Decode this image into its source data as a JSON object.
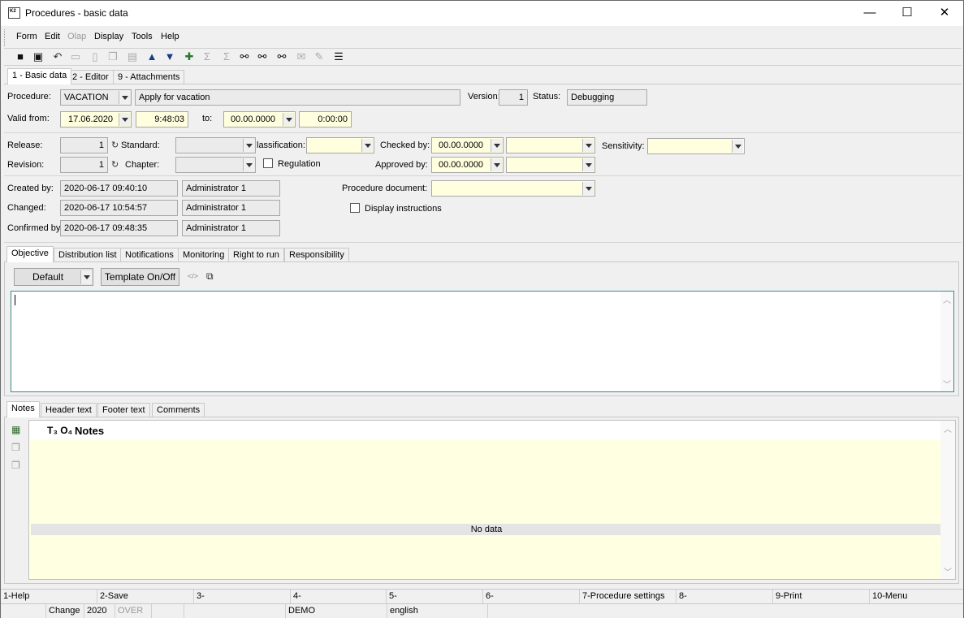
{
  "window": {
    "title": "Procedures - basic data",
    "app_icon_text": "K2",
    "minimize": "—",
    "maximize": "☐",
    "close": "✕"
  },
  "menu": [
    "Form",
    "Edit",
    "Olap",
    "Display",
    "Tools",
    "Help"
  ],
  "toolbar": [
    "save-icon",
    "save-close-icon",
    "undo-icon",
    "open-folder-icon",
    "new-page-icon",
    "copy-page-icon",
    "book-icon",
    "arrow-up-icon",
    "arrow-down-icon",
    "filter-icon",
    "sum-icon",
    "sum-filter-icon",
    "binoculars-icon",
    "binoculars-next-icon",
    "binoculars-prev-icon",
    "mail-icon",
    "edit-icon",
    "menu-lines-icon"
  ],
  "top_tabs": [
    "1 - Basic data",
    "2 - Editor",
    "9 - Attachments"
  ],
  "form": {
    "procedure_label": "Procedure:",
    "procedure_code": "VACATION",
    "procedure_name": "Apply for vacation",
    "version_label": "Version:",
    "version_value": "1",
    "status_label": "Status:",
    "status_value": "Debugging",
    "valid_from_label": "Valid from:",
    "valid_from_date": "17.06.2020",
    "valid_from_time": "9:48:03",
    "to_label": "to:",
    "to_date": "00.00.0000",
    "to_time": "0:00:00",
    "release_label": "Release:",
    "release_value": "1",
    "standard_label": "Standard:",
    "classification_label": "lassification:",
    "checked_by_label": "Checked by:",
    "checked_by_date": "00.00.0000",
    "sensitivity_label": "Sensitivity:",
    "revision_label": "Revision:",
    "revision_value": "1",
    "chapter_label": "Chapter:",
    "regulation_label": "Regulation",
    "approved_by_label": "Approved by:",
    "approved_by_date": "00.00.0000",
    "created_by_label": "Created by:",
    "created_by_date": "2020-06-17 09:40:10",
    "created_by_user": "Administrator 1",
    "changed_label": "Changed:",
    "changed_date": "2020-06-17 10:54:57",
    "changed_user": "Administrator 1",
    "confirmed_label": "Confirmed by",
    "confirmed_date": "2020-06-17 09:48:35",
    "confirmed_user": "Administrator 1",
    "procedure_document_label": "Procedure document:",
    "display_instructions_label": "Display instructions"
  },
  "mid_tabs": [
    "Objective",
    "Distribution list",
    "Notifications",
    "Monitoring",
    "Right to run",
    "Responsibility"
  ],
  "objective": {
    "template_select": "Default",
    "template_toggle": "Template On/Off",
    "code_icon": "</>",
    "popout_icon": "⧉"
  },
  "notes_tabs": [
    "Notes",
    "Header text",
    "Footer text",
    "Comments"
  ],
  "notes_grid": {
    "col_icons": "T₃ O₄",
    "col_header": "Notes",
    "empty_text": "No data"
  },
  "fkeys": [
    "1-Help",
    "2-Save",
    "3-",
    "4-",
    "5-",
    "6-",
    "7-Procedure settings",
    "8-",
    "9-Print",
    "10-Menu"
  ],
  "status_bar": [
    "",
    "Change",
    "2020",
    "OVER",
    "",
    "",
    "DEMO",
    "english",
    ""
  ]
}
